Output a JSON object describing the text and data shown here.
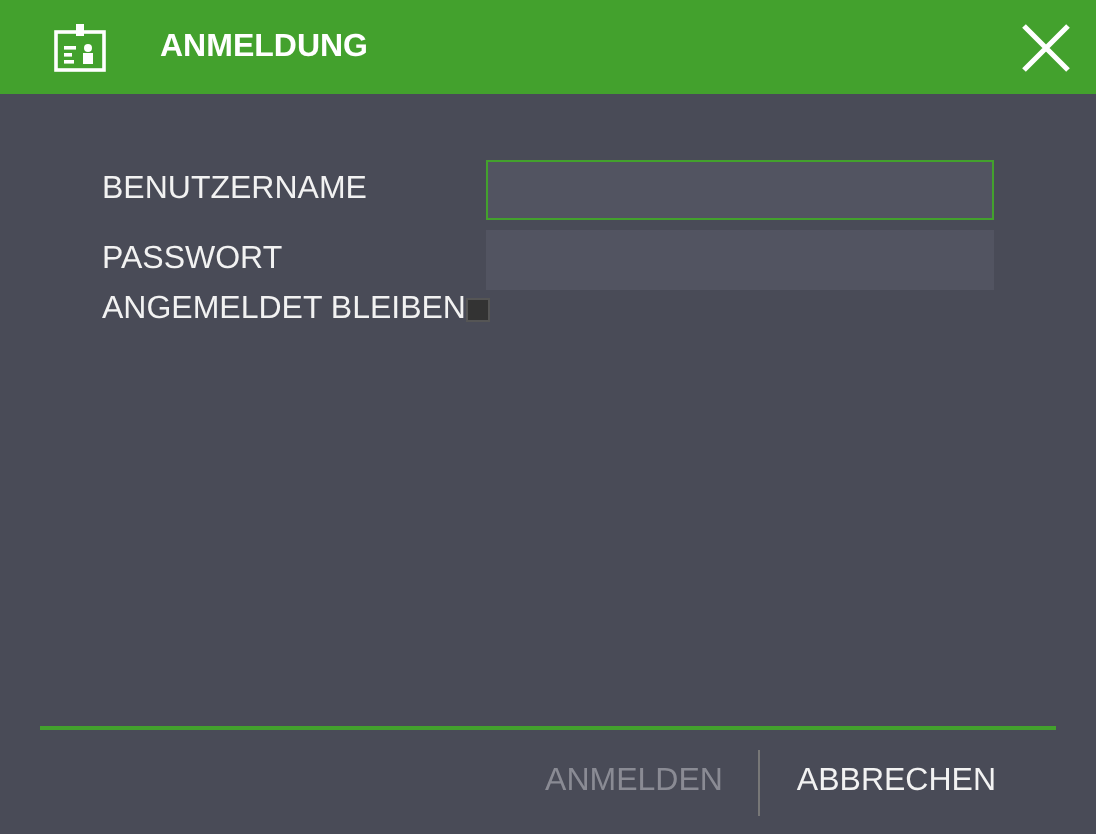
{
  "window": {
    "title": "ANMELDUNG"
  },
  "fields": [
    {
      "label": "BENUTZERNAME",
      "focused": true
    },
    {
      "label": "PASSWORT",
      "focused": false
    }
  ],
  "remember": {
    "label": "ANGEMELDET BLEIBEN",
    "checked": false
  },
  "buttons": [
    {
      "label": "ANMELDEN",
      "disabled": true
    },
    {
      "label": "ABBRECHEN",
      "disabled": false
    }
  ]
}
